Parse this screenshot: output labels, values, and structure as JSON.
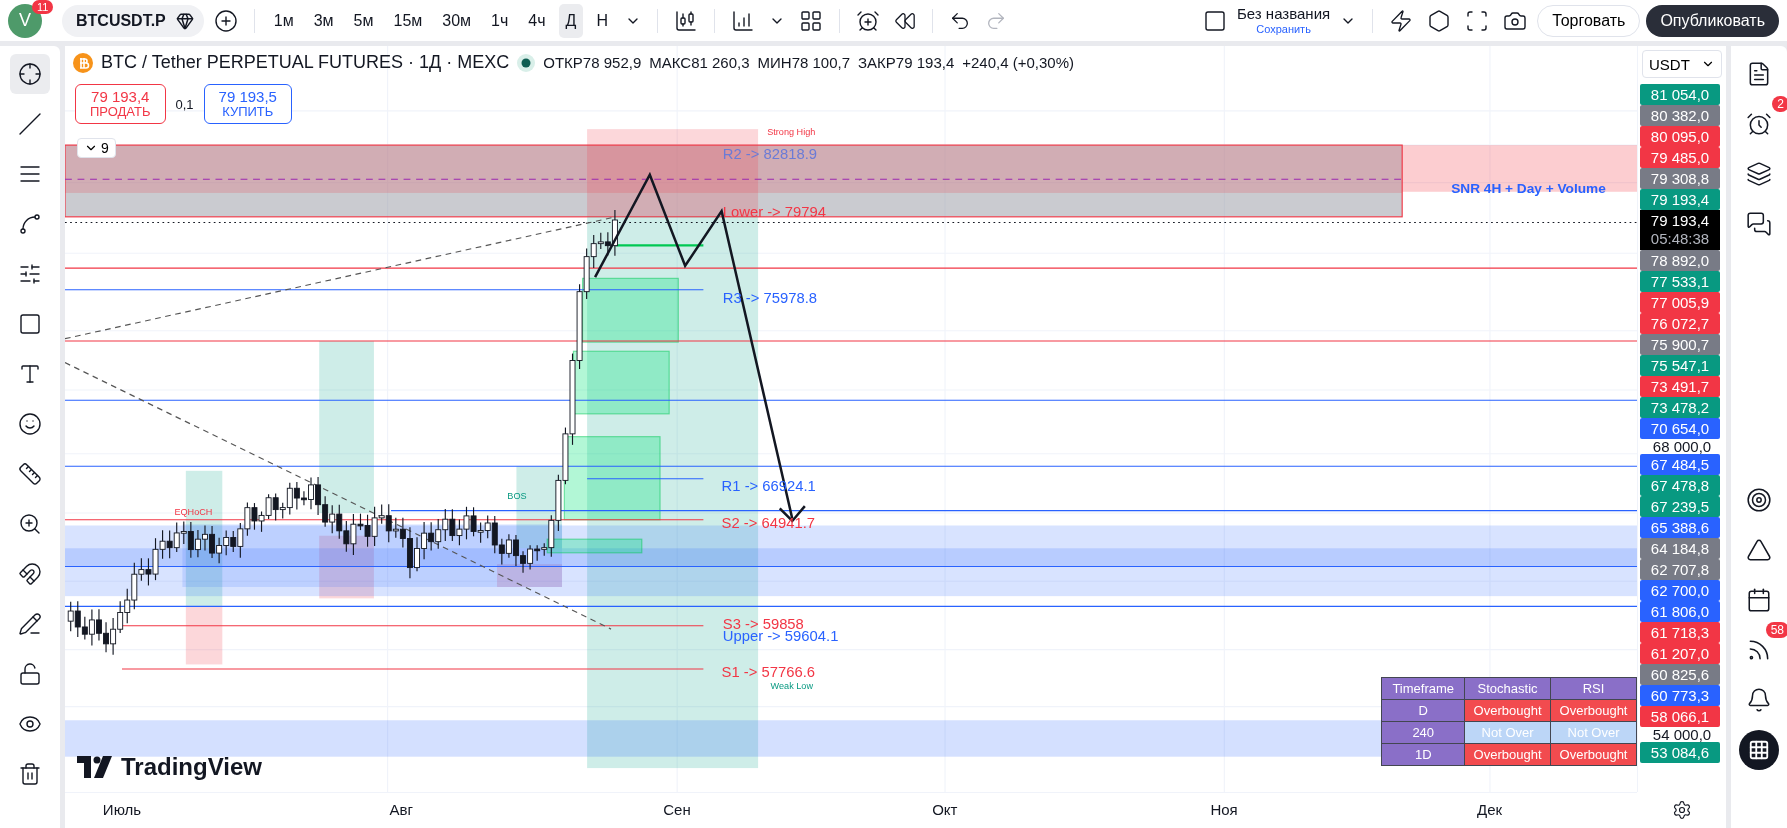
{
  "avatar": {
    "letter": "V",
    "badge": "11"
  },
  "symbol": "BTCUSDT.P",
  "intervals": [
    {
      "label": "1м",
      "selected": false
    },
    {
      "label": "3м",
      "selected": false
    },
    {
      "label": "5м",
      "selected": false
    },
    {
      "label": "15м",
      "selected": false
    },
    {
      "label": "30м",
      "selected": false
    },
    {
      "label": "1ч",
      "selected": false
    },
    {
      "label": "4ч",
      "selected": false
    },
    {
      "label": "Д",
      "selected": true
    },
    {
      "label": "Н",
      "selected": false
    }
  ],
  "layout": {
    "title": "Без названия",
    "action": "Сохранить"
  },
  "buttons": {
    "trade": "Торговать",
    "publish": "Опубликовать"
  },
  "tools": [
    {
      "selected": true
    },
    {
      "selected": false
    },
    {
      "selected": false
    },
    {
      "selected": false
    },
    {
      "selected": false
    },
    {
      "selected": false
    },
    {
      "selected": false
    },
    {
      "selected": false
    },
    {
      "selected": false
    },
    {
      "selected": false
    },
    {
      "selected": false
    },
    {
      "selected": false
    },
    {
      "selected": false
    },
    {
      "selected": false
    },
    {
      "selected": false
    }
  ],
  "legend": {
    "title": "BTC / Tether PERPETUAL FUTURES · 1Д · MEXC",
    "stats": [
      {
        "label": "ОТКР",
        "value": "78 952,9"
      },
      {
        "label": "МАКС",
        "value": "81 260,3"
      },
      {
        "label": "МИН",
        "value": "78 100,7"
      },
      {
        "label": "ЗАКР",
        "value": "79 193,4"
      }
    ],
    "change": "+240,4 (+0,30%)"
  },
  "order": {
    "sell_price": "79 193,4",
    "sell_label": "ПРОДАТЬ",
    "spread": "0,1",
    "buy_price": "79 193,5",
    "buy_label": "КУПИТЬ"
  },
  "indicators_toggle": "9",
  "currency": "USDT",
  "chart_labels": [
    {
      "text": "Strong High",
      "kind": "high"
    },
    {
      "text": "R2 -> 82818.9",
      "kind": "muted"
    },
    {
      "text": "Lower -> 79794",
      "kind": "support"
    },
    {
      "text": "R3 -> 75978.8",
      "kind": "resistance"
    },
    {
      "text": "R1 -> 66924.1",
      "kind": "resistance"
    },
    {
      "text": "S2 -> 64941.7",
      "kind": "support"
    },
    {
      "text": "S3 -> 59858",
      "kind": "support"
    },
    {
      "text": "Upper -> 59604.1",
      "kind": "resistance"
    },
    {
      "text": "S1 -> 57766.6",
      "kind": "support"
    },
    {
      "text": "Weak Low",
      "kind": "low"
    },
    {
      "text": "SNR 4H + Day + Volume",
      "kind": "zone"
    },
    {
      "text": "EQHoCH",
      "kind": "high"
    },
    {
      "text": "BOS",
      "kind": "low"
    }
  ],
  "price_axis": [
    {
      "text": "81 054,0",
      "kind": "tag",
      "color": "#089981"
    },
    {
      "text": "80 382,0",
      "kind": "tag",
      "color": "#787b86"
    },
    {
      "text": "80 095,0",
      "kind": "tag",
      "color": "#f23645"
    },
    {
      "text": "79 485,0",
      "kind": "tag",
      "color": "#f23645"
    },
    {
      "text": "79 308,8",
      "kind": "tag",
      "color": "#787b86"
    },
    {
      "text": "79 193,4",
      "kind": "tag",
      "color": "#089981"
    },
    {
      "text": "79 193,4",
      "kind": "current",
      "timer": "05:48:38"
    },
    {
      "text": "78 892,0",
      "kind": "tag",
      "color": "#787b86"
    },
    {
      "text": "77 533,1",
      "kind": "tag",
      "color": "#089981"
    },
    {
      "text": "77 005,9",
      "kind": "tag",
      "color": "#f23645"
    },
    {
      "text": "76 072,7",
      "kind": "tag",
      "color": "#f23645"
    },
    {
      "text": "75 900,7",
      "kind": "tag",
      "color": "#787b86"
    },
    {
      "text": "75 547,1",
      "kind": "tag",
      "color": "#089981"
    },
    {
      "text": "73 491,7",
      "kind": "tag",
      "color": "#f23645"
    },
    {
      "text": "73 478,2",
      "kind": "tag",
      "color": "#089981"
    },
    {
      "text": "70 654,0",
      "kind": "tag",
      "color": "#2962ff"
    },
    {
      "text": "68 000,0",
      "kind": "plain"
    },
    {
      "text": "67 484,5",
      "kind": "tag",
      "color": "#2962ff"
    },
    {
      "text": "67 478,8",
      "kind": "tag",
      "color": "#089981"
    },
    {
      "text": "67 239,5",
      "kind": "tag",
      "color": "#089981"
    },
    {
      "text": "65 388,6",
      "kind": "tag",
      "color": "#2962ff"
    },
    {
      "text": "64 184,8",
      "kind": "tag",
      "color": "#787b86"
    },
    {
      "text": "62 707,8",
      "kind": "tag",
      "color": "#787b86"
    },
    {
      "text": "62 700,0",
      "kind": "tag",
      "color": "#2962ff"
    },
    {
      "text": "61 806,0",
      "kind": "tag",
      "color": "#2962ff"
    },
    {
      "text": "61 718,3",
      "kind": "tag",
      "color": "#f23645"
    },
    {
      "text": "61 207,0",
      "kind": "tag",
      "color": "#f23645"
    },
    {
      "text": "60 825,6",
      "kind": "tag",
      "color": "#787b86"
    },
    {
      "text": "60 773,3",
      "kind": "tag",
      "color": "#2962ff"
    },
    {
      "text": "58 066,1",
      "kind": "tag",
      "color": "#f23645"
    },
    {
      "text": "54 000,0",
      "kind": "plain"
    },
    {
      "text": "53 084,6",
      "kind": "tag",
      "color": "#089981"
    }
  ],
  "table": {
    "columns": [
      "Timeframe",
      "Stochastic",
      "RSI"
    ],
    "rows": [
      {
        "cells": [
          {
            "text": "D",
            "kind": "label"
          },
          {
            "text": "Overbought",
            "kind": "over"
          },
          {
            "text": "Overbought",
            "kind": "over"
          }
        ]
      },
      {
        "cells": [
          {
            "text": "240",
            "kind": "label"
          },
          {
            "text": "Not Over",
            "kind": "neutral"
          },
          {
            "text": "Not Over",
            "kind": "neutral"
          }
        ]
      },
      {
        "cells": [
          {
            "text": "1D",
            "kind": "label"
          },
          {
            "text": "Overbought",
            "kind": "over"
          },
          {
            "text": "Overbought",
            "kind": "over"
          }
        ]
      }
    ]
  },
  "logo": "TradingView",
  "time_axis": [
    "Июль",
    "Авг",
    "Сен",
    "Окт",
    "Ноя",
    "Дек"
  ],
  "sidebar_badges": {
    "alerts": "2",
    "news": "58"
  }
}
